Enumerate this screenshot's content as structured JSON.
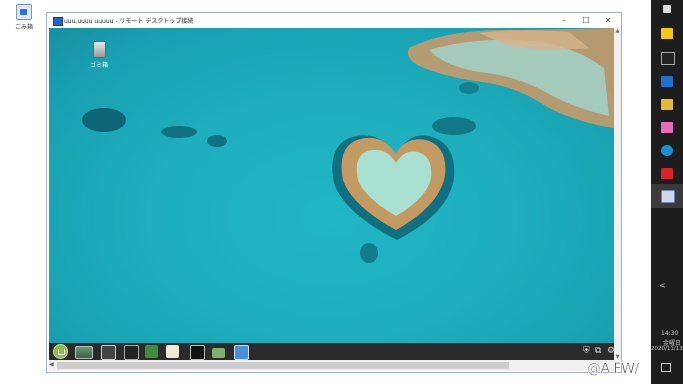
{
  "host_desktop": {
    "icon_label": "ごみ箱"
  },
  "window": {
    "title": "uuu.uuuu uuuuu - リモート デスクトップ接続",
    "controls": {
      "minimize": "–",
      "maximize": "☐",
      "close": "✕"
    }
  },
  "remote_desktop": {
    "trash_label": "ゴミ箱",
    "taskbar": {
      "items": [
        "menu-icon",
        "show-desktop-icon",
        "home-folder-icon",
        "system-monitor-icon",
        "calc-icon",
        "writer-icon",
        "terminal-icon",
        "files-icon",
        "remote-icon"
      ],
      "tray": {
        "shield": "⛨",
        "clip": "⧉",
        "network": "⚙"
      }
    }
  },
  "scrollbars": {
    "up": "▲",
    "down": "▼",
    "left": "◀"
  },
  "host_taskbar": {
    "chevron": "<",
    "time": "14:30",
    "day": "金曜日",
    "date": "2020/11/13"
  },
  "overlay_text": "@A FW/"
}
